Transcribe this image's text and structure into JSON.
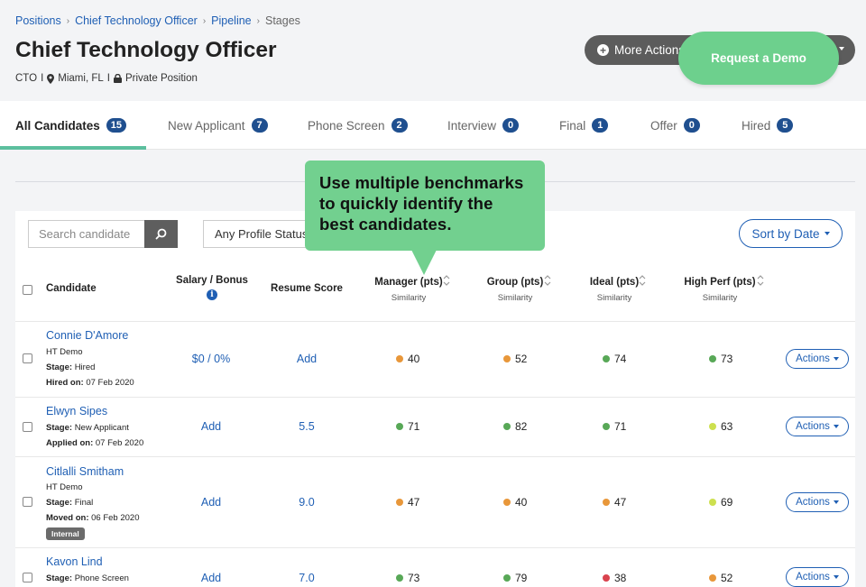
{
  "breadcrumb": {
    "items": [
      "Positions",
      "Chief Technology Officer",
      "Pipeline"
    ],
    "current": "Stages",
    "separator": "›"
  },
  "page": {
    "title": "Chief Technology Officer",
    "code": "CTO",
    "location": "Miami, FL",
    "privacy": "Private Position",
    "separator": "I"
  },
  "header_actions": {
    "more_actions": "More Actions",
    "request_demo": "Request a Demo"
  },
  "tabs": [
    {
      "label": "All Candidates",
      "count": "15"
    },
    {
      "label": "New Applicant",
      "count": "7"
    },
    {
      "label": "Phone Screen",
      "count": "2"
    },
    {
      "label": "Interview",
      "count": "0"
    },
    {
      "label": "Final",
      "count": "1"
    },
    {
      "label": "Offer",
      "count": "0"
    },
    {
      "label": "Hired",
      "count": "5"
    }
  ],
  "filters": {
    "search_placeholder": "Search candidate",
    "profile_status": "Any Profile Status",
    "sort": "Sort by Date"
  },
  "callout": {
    "text": "Use multiple benchmarks to quickly identify the best candidates."
  },
  "columns": {
    "candidate": "Candidate",
    "salary": "Salary / Bonus",
    "resume": "Resume Score",
    "manager": "Manager (pts)",
    "group": "Group (pts)",
    "ideal": "Ideal (pts)",
    "highperf": "High Perf (pts)",
    "similarity": "Similarity"
  },
  "colors": {
    "orange": "#e8973a",
    "green": "#58a857",
    "lime": "#cde04f",
    "red": "#d9434e",
    "brand_blue": "#1f5fb4",
    "demo_green": "#6dd08d"
  },
  "actions_label": "Actions",
  "labels": {
    "stage": "Stage:",
    "hired_on": "Hired on:",
    "applied_on": "Applied on:",
    "moved_on": "Moved on:"
  },
  "rows": [
    {
      "name": "Connie D'Amore",
      "company": "HT Demo",
      "stage": "Hired",
      "date": "07 Feb 2020",
      "salary": "$0 / 0%",
      "resume": "Add",
      "manager": "40",
      "group": "52",
      "ideal": "74",
      "highperf": "73"
    },
    {
      "name": "Elwyn Sipes",
      "stage": "New Applicant",
      "date": "07 Feb 2020",
      "salary": "Add",
      "resume": "5.5",
      "manager": "71",
      "group": "82",
      "ideal": "71",
      "highperf": "63"
    },
    {
      "name": "Citlalli Smitham",
      "company": "HT Demo",
      "stage": "Final",
      "date": "06 Feb 2020",
      "tag": "Internal",
      "salary": "Add",
      "resume": "9.0",
      "manager": "47",
      "group": "40",
      "ideal": "47",
      "highperf": "69"
    },
    {
      "name": "Kavon Lind",
      "stage": "Phone Screen",
      "salary": "Add",
      "resume": "7.0",
      "manager": "73",
      "group": "79",
      "ideal": "38",
      "highperf": "52"
    }
  ]
}
